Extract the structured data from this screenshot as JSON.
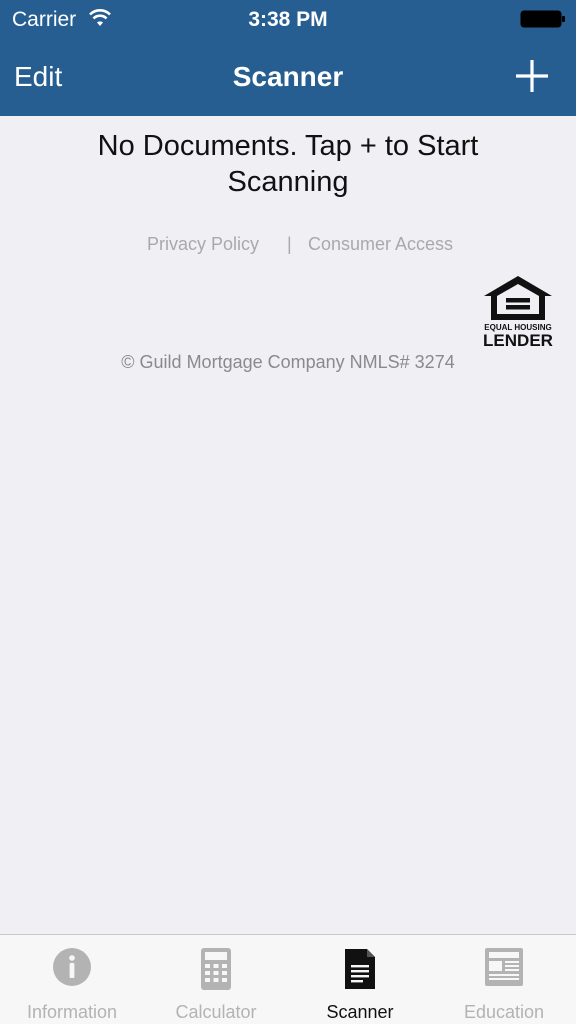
{
  "status_bar": {
    "carrier": "Carrier",
    "time": "3:38 PM"
  },
  "nav": {
    "edit_label": "Edit",
    "title": "Scanner",
    "add_icon": "plus-icon"
  },
  "content": {
    "empty_message": "No Documents. Tap + to Start Scanning",
    "privacy_link": "Privacy Policy",
    "separator": "|",
    "consumer_link": "Consumer Access",
    "logo_text_top": "EQUAL HOUSING",
    "logo_text_bottom": "LENDER",
    "copyright": "© Guild Mortgage Company NMLS# 3274"
  },
  "tabs": [
    {
      "label": "Information",
      "icon": "info-icon",
      "active": false
    },
    {
      "label": "Calculator",
      "icon": "calculator-icon",
      "active": false
    },
    {
      "label": "Scanner",
      "icon": "document-icon",
      "active": true
    },
    {
      "label": "Education",
      "icon": "newspaper-icon",
      "active": false
    }
  ],
  "colors": {
    "nav_background": "#265e91",
    "page_background": "#efeff4",
    "tab_inactive": "#b3b3b3",
    "tab_active": "#111111"
  }
}
